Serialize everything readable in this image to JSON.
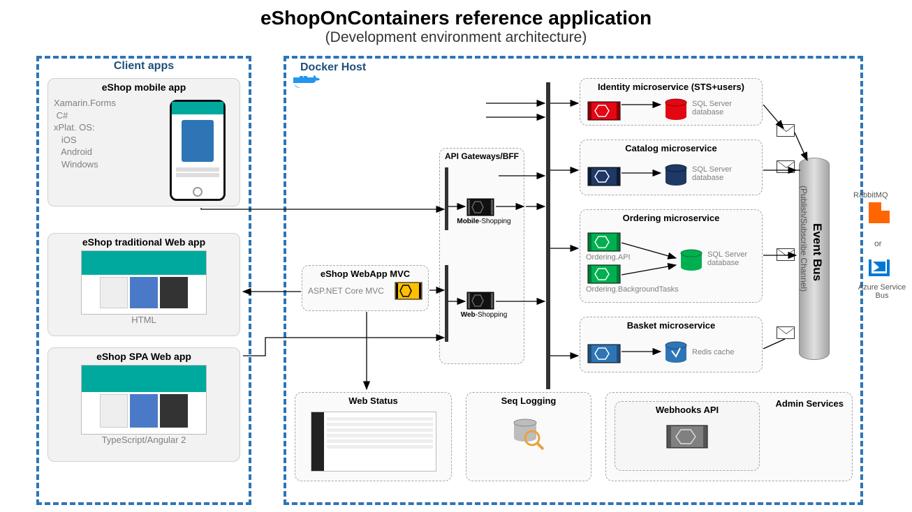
{
  "title": "eShopOnContainers reference application",
  "subtitle": "(Development environment architecture)",
  "client": {
    "region_label": "Client apps",
    "mobile_title": "eShop mobile app",
    "mobile_tech": "Xamarin.Forms\n C#\nxPlat. OS:\n   iOS\n   Android\n   Windows",
    "trad_title": "eShop traditional Web app",
    "trad_tech": "HTML",
    "spa_title": "eShop SPA Web app",
    "spa_tech": "TypeScript/Angular 2"
  },
  "docker": {
    "region_label": "Docker Host",
    "mvc_title": "eShop WebApp MVC",
    "mvc_tech": "ASP.NET Core MVC",
    "gateway_title": "API Gateways/BFF",
    "gw_mobile_a": "Mobile",
    "gw_mobile_b": "-Shopping",
    "gw_web_a": "Web",
    "gw_web_b": "-Shopping",
    "webstatus_title": "Web Status",
    "seq_title": "Seq Logging",
    "webhooks_title": "Webhooks API",
    "admin_title": "Admin Services"
  },
  "ms": {
    "identity_title": "Identity microservice (STS+users)",
    "catalog_title": "Catalog microservice",
    "ordering_title": "Ordering microservice",
    "ordering_api": "Ordering.API",
    "ordering_bg": "Ordering.BackgroundTasks",
    "basket_title": "Basket microservice",
    "sql": "SQL Server database",
    "redis": "Redis cache"
  },
  "eventbus": {
    "name": "Event Bus",
    "sub": "(Publish/Subscribe Channel)",
    "rabbit": "RabbitMQ",
    "or": "or",
    "azure": "Azure Service Bus"
  }
}
